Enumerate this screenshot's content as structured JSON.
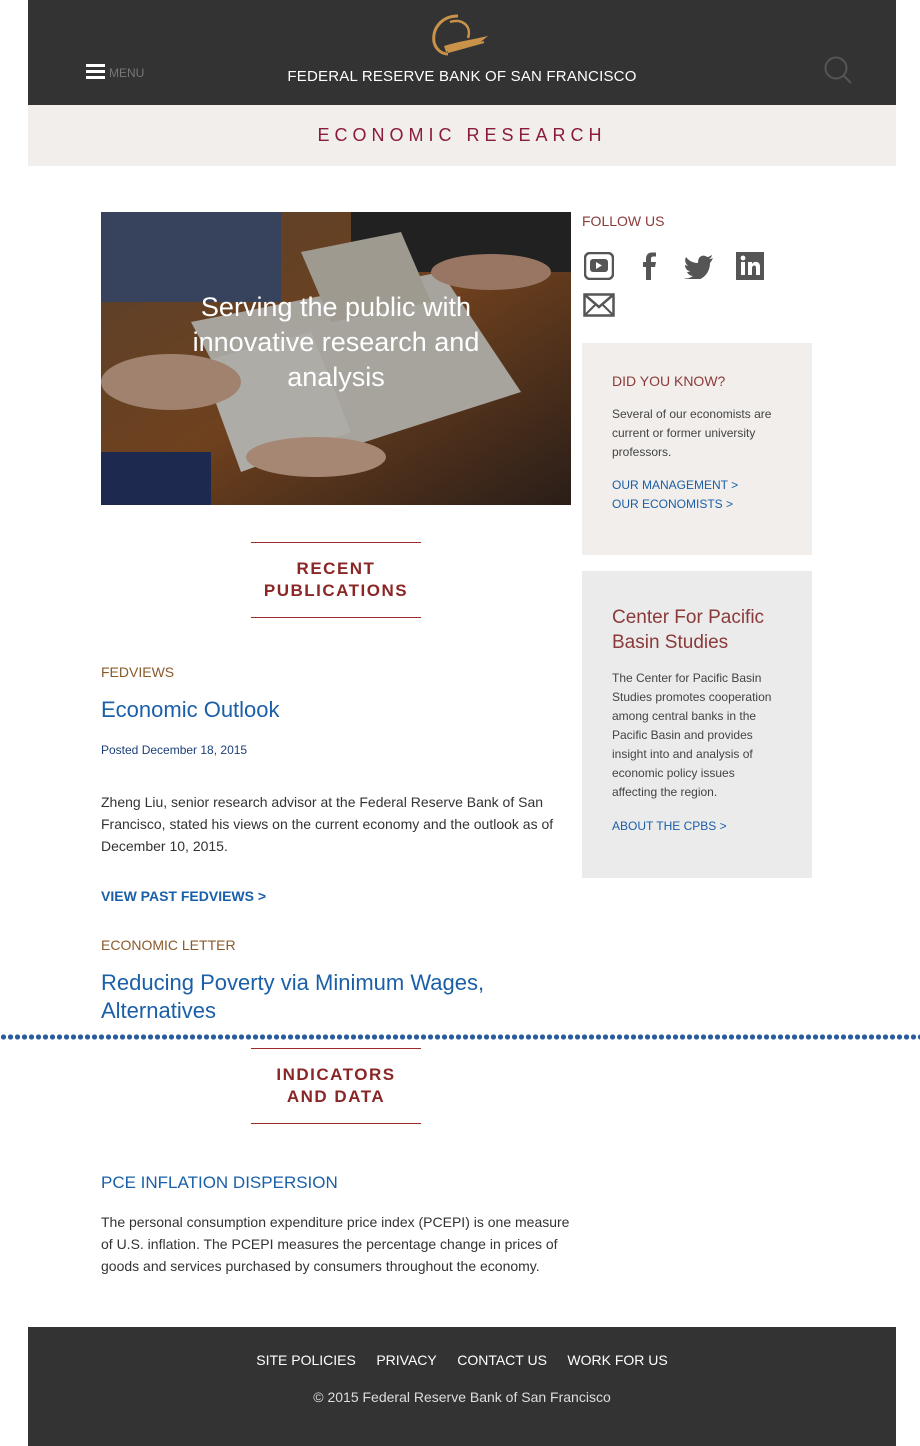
{
  "header": {
    "site_title": "FEDERAL RESERVE BANK OF SAN FRANCISCO",
    "menu_label": "MENU",
    "section_label": "ECONOMIC RESEARCH"
  },
  "hero": {
    "caption": "Serving the public with innovative research and analysis"
  },
  "follow": {
    "label": "FOLLOW US",
    "icons": [
      "youtube-icon",
      "facebook-icon",
      "twitter-icon",
      "linkedin-icon",
      "email-icon"
    ]
  },
  "did_you_know": {
    "title": "DID YOU KNOW?",
    "body": "Several of our economists are current or former university professors.",
    "links": [
      "OUR MANAGEMENT >",
      "OUR ECONOMISTS >"
    ]
  },
  "cpbs": {
    "title": "Center For Pacific Basin Studies",
    "body": "The Center for Pacific Basin Studies promotes cooperation among central banks in the Pacific Basin and provides insight into and analysis of economic policy issues affecting the region.",
    "link": "ABOUT THE CPBS >"
  },
  "recent": {
    "heading_line1": "RECENT",
    "heading_line2": "PUBLICATIONS",
    "fedviews": {
      "category": "FEDVIEWS",
      "title": "Economic Outlook",
      "posted": "Posted December 18, 2015",
      "summary": "Zheng Liu, senior research advisor at the Federal Reserve Bank of San Francisco, stated his views on the current economy and the outlook as of December 10, 2015.",
      "link": "VIEW PAST FEDVIEWS >"
    },
    "letter": {
      "category": "ECONOMIC LETTER",
      "title_line1": "Reducing Poverty via Minimum Wages,",
      "title_line2": "Alternatives"
    }
  },
  "indicators": {
    "heading_line1": "INDICATORS",
    "heading_line2": "AND DATA",
    "item_title": "PCE INFLATION DISPERSION",
    "item_body": "The personal consumption expenditure price index (PCEPI) is one measure of U.S. inflation. The PCEPI measures the percentage change in prices of goods and services purchased by consumers throughout the economy."
  },
  "footer": {
    "links": [
      "SITE POLICIES",
      "PRIVACY",
      "CONTACT US",
      "WORK FOR US"
    ],
    "copyright": "© 2015 Federal Reserve Bank of San Francisco"
  }
}
